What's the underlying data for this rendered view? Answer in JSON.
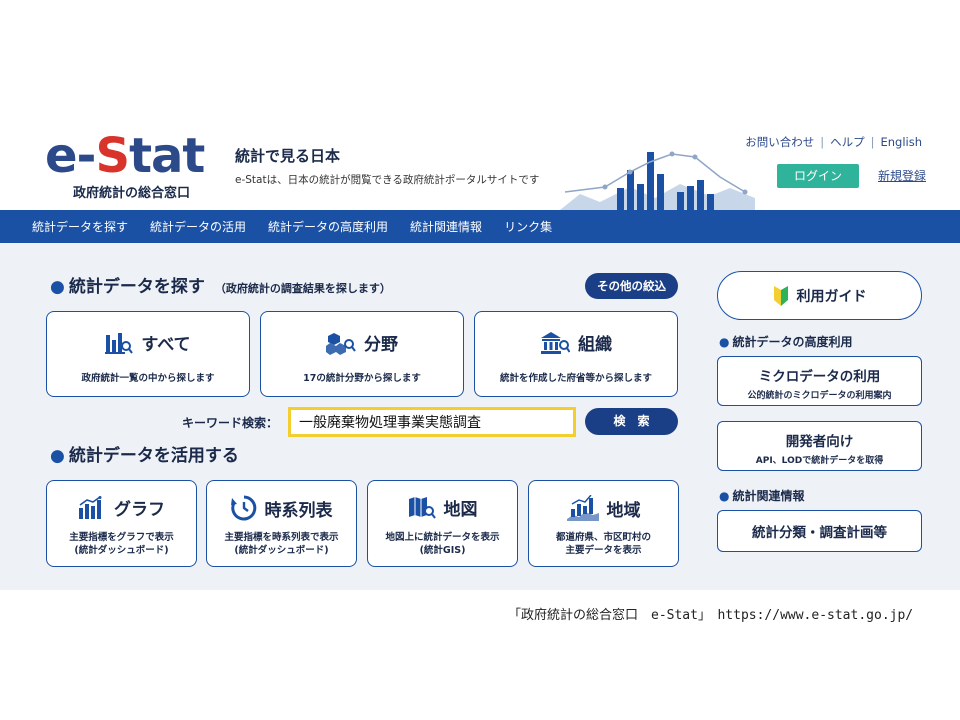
{
  "brand": {
    "logo_part1": "e-",
    "logo_part2": "S",
    "logo_part3": "tat",
    "logo_subtitle": "政府統計の総合窓口",
    "tagline": "統計で見る日本",
    "tagline_sub": "e-Statは、日本の統計が閲覧できる政府統計ポータルサイトです",
    "accent_color": "#d9342b",
    "brand_color": "#2c4a8a"
  },
  "util_links": {
    "contact": "お問い合わせ",
    "help": "ヘルプ",
    "english": "English",
    "separator": "|"
  },
  "auth": {
    "login": "ログイン",
    "register": "新規登録",
    "login_color": "#2fb39b"
  },
  "nav": {
    "color": "#1b51a4",
    "items": [
      {
        "label": "統計データを探す"
      },
      {
        "label": "統計データの活用"
      },
      {
        "label": "統計データの高度利用"
      },
      {
        "label": "統計関連情報"
      },
      {
        "label": "リンク集"
      }
    ]
  },
  "search_section": {
    "bullet": "●",
    "title": "統計データを探す",
    "note": "（政府統計の調査結果を探します）",
    "filter_button": "その他の絞込",
    "cards": [
      {
        "title": "すべて",
        "desc": "政府統計一覧の中から探します",
        "icon": "chart-search-icon"
      },
      {
        "title": "分野",
        "desc": "17の統計分野から探します",
        "icon": "cubes-search-icon"
      },
      {
        "title": "組織",
        "desc": "統計を作成した府省等から探します",
        "icon": "building-search-icon"
      }
    ],
    "keyword_label": "キーワード検索：",
    "keyword_value": "一般廃棄物処理事業実態調査",
    "search_button": "検　索",
    "highlight_color": "#f2cf2e"
  },
  "use_section": {
    "bullet": "●",
    "title": "統計データを活用する",
    "cards": [
      {
        "title": "グラフ",
        "desc1": "主要指標をグラフで表示",
        "desc2": "(統計ダッシュボード)",
        "icon": "bar-graph-icon"
      },
      {
        "title": "時系列表",
        "desc1": "主要指標を時系列表で表示",
        "desc2": "(統計ダッシュボード)",
        "icon": "clock-icon"
      },
      {
        "title": "地図",
        "desc1": "地図上に統計データを表示",
        "desc2": "(統計GIS)",
        "icon": "map-search-icon"
      },
      {
        "title": "地域",
        "desc1": "都道府県、市区町村の",
        "desc2": "主要データを表示",
        "icon": "region-bars-icon"
      }
    ]
  },
  "sidebar": {
    "guide": "利用ガイド",
    "advanced_heading": "統計データの高度利用",
    "micro_title": "ミクロデータの利用",
    "micro_sub": "公的統計のミクロデータの利用案内",
    "dev_title": "開発者向け",
    "dev_sub": "API、LODで統計データを取得",
    "related_heading": "統計関連情報",
    "classification": "統計分類・調査計画等",
    "bullet": "●"
  },
  "caption": "「政府統計の総合窓口　e-Stat」　https://www.e-stat.go.jp/"
}
